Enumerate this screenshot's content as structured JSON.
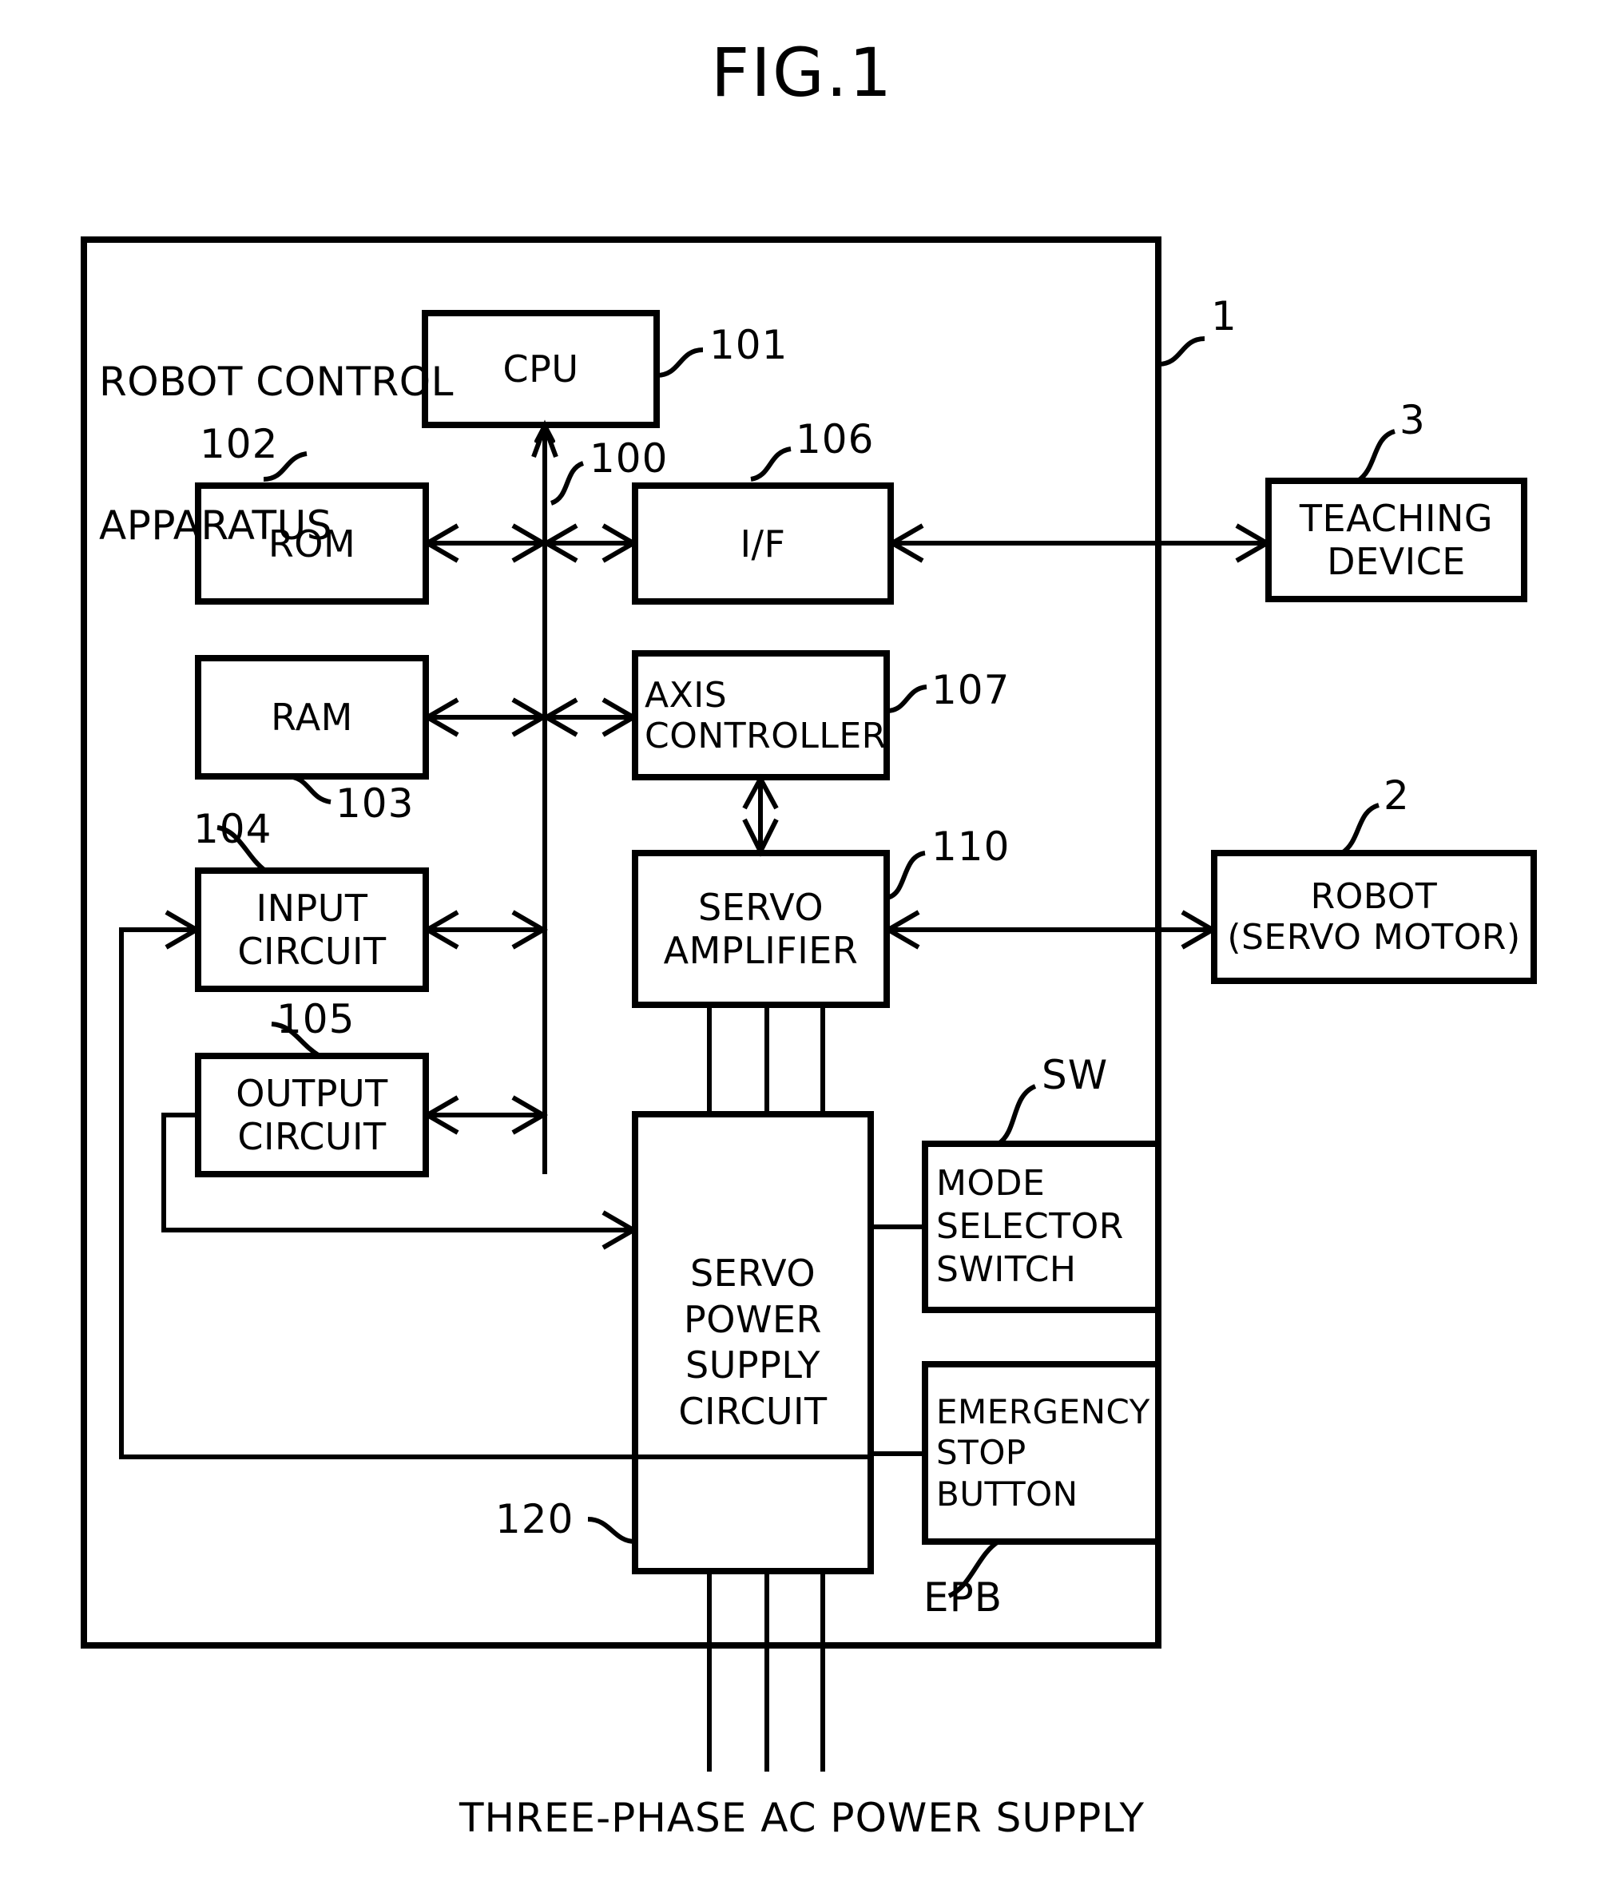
{
  "figure": {
    "title": "FIG.1",
    "caption": "THREE-PHASE AC POWER SUPPLY"
  },
  "apparatus": {
    "name_line1": "ROBOT CONTROL",
    "name_line2": "APPARATUS",
    "ref": "1"
  },
  "blocks": {
    "cpu": {
      "label": "CPU",
      "ref": "101"
    },
    "bus": {
      "ref": "100"
    },
    "rom": {
      "label": "ROM",
      "ref": "102"
    },
    "ram": {
      "label": "RAM",
      "ref": "103"
    },
    "input_circuit": {
      "label_line1": "INPUT",
      "label_line2": "CIRCUIT",
      "ref": "104"
    },
    "output_circuit": {
      "label_line1": "OUTPUT",
      "label_line2": "CIRCUIT",
      "ref": "105"
    },
    "interface": {
      "label": "I/F",
      "ref": "106"
    },
    "axis_controller": {
      "label_line1": "AXIS",
      "label_line2": "CONTROLLER",
      "ref": "107"
    },
    "servo_amplifier": {
      "label_line1": "SERVO",
      "label_line2": "AMPLIFIER",
      "ref": "110"
    },
    "servo_power_supply": {
      "label_line1": "SERVO",
      "label_line2": "POWER",
      "label_line3": "SUPPLY",
      "label_line4": "CIRCUIT",
      "ref": "120"
    },
    "mode_selector_switch": {
      "label_line1": "MODE",
      "label_line2": "SELECTOR",
      "label_line3": "SWITCH",
      "ref": "SW"
    },
    "emergency_stop_button": {
      "label_line1": "EMERGENCY",
      "label_line2": "STOP",
      "label_line3": "BUTTON",
      "ref": "EPB"
    },
    "teaching_device": {
      "label_line1": "TEACHING",
      "label_line2": "DEVICE",
      "ref": "3"
    },
    "robot": {
      "label_line1": "ROBOT",
      "label_line2": "(SERVO MOTOR)",
      "ref": "2"
    }
  },
  "style": {
    "ink": "#000000",
    "paper": "#ffffff"
  },
  "chart_data": {
    "type": "diagram",
    "title": "FIG.1",
    "nodes": [
      {
        "id": "1",
        "label": "ROBOT CONTROL APPARATUS",
        "kind": "enclosure"
      },
      {
        "id": "101",
        "label": "CPU",
        "kind": "block"
      },
      {
        "id": "100",
        "label": "BUS",
        "kind": "bus"
      },
      {
        "id": "102",
        "label": "ROM",
        "kind": "block"
      },
      {
        "id": "103",
        "label": "RAM",
        "kind": "block"
      },
      {
        "id": "104",
        "label": "INPUT CIRCUIT",
        "kind": "block"
      },
      {
        "id": "105",
        "label": "OUTPUT CIRCUIT",
        "kind": "block"
      },
      {
        "id": "106",
        "label": "I/F",
        "kind": "block"
      },
      {
        "id": "107",
        "label": "AXIS CONTROLLER",
        "kind": "block"
      },
      {
        "id": "110",
        "label": "SERVO AMPLIFIER",
        "kind": "block"
      },
      {
        "id": "120",
        "label": "SERVO POWER SUPPLY CIRCUIT",
        "kind": "block"
      },
      {
        "id": "SW",
        "label": "MODE SELECTOR SWITCH",
        "kind": "block"
      },
      {
        "id": "EPB",
        "label": "EMERGENCY STOP BUTTON",
        "kind": "block"
      },
      {
        "id": "3",
        "label": "TEACHING DEVICE",
        "kind": "external"
      },
      {
        "id": "2",
        "label": "ROBOT (SERVO MOTOR)",
        "kind": "external"
      }
    ],
    "edges": [
      {
        "from": "101",
        "to": "100",
        "arrow": "both"
      },
      {
        "from": "102",
        "to": "100",
        "arrow": "both"
      },
      {
        "from": "103",
        "to": "100",
        "arrow": "both"
      },
      {
        "from": "104",
        "to": "100",
        "arrow": "both"
      },
      {
        "from": "105",
        "to": "100",
        "arrow": "both"
      },
      {
        "from": "100",
        "to": "106",
        "arrow": "both"
      },
      {
        "from": "100",
        "to": "107",
        "arrow": "both"
      },
      {
        "from": "106",
        "to": "3",
        "arrow": "both"
      },
      {
        "from": "107",
        "to": "110",
        "arrow": "both"
      },
      {
        "from": "110",
        "to": "2",
        "arrow": "both"
      },
      {
        "from": "110",
        "to": "120",
        "arrow": "none",
        "lines": 3
      },
      {
        "from": "120",
        "to": "SW",
        "arrow": "none"
      },
      {
        "from": "120",
        "to": "EPB",
        "arrow": "none"
      },
      {
        "from": "SW",
        "to": "104",
        "arrow": "single"
      },
      {
        "from": "EPB",
        "to": "104",
        "arrow": "single"
      },
      {
        "from": "105",
        "to": "120",
        "arrow": "single"
      },
      {
        "from": "120",
        "to": "THREE-PHASE AC POWER SUPPLY",
        "arrow": "none",
        "lines": 3
      }
    ]
  }
}
